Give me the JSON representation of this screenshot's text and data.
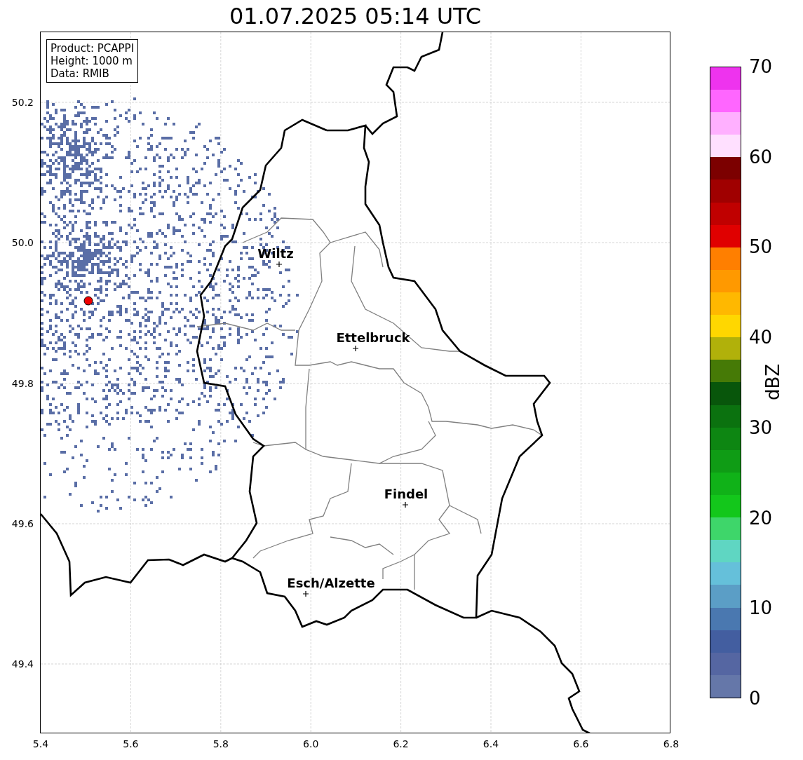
{
  "title": "01.07.2025 05:14 UTC",
  "info_box": [
    "Product: PCAPPI",
    "Height: 1000 m",
    "Data: RMIB"
  ],
  "cities": [
    {
      "name": "Wiltz"
    },
    {
      "name": "Ettelbruck"
    },
    {
      "name": "Findel"
    },
    {
      "name": "Esch/Alzette"
    }
  ],
  "x_ticks": [
    "5.4",
    "5.6",
    "5.8",
    "6.0",
    "6.2",
    "6.4",
    "6.6",
    "6.8"
  ],
  "y_ticks": [
    "50.2",
    "50.0",
    "49.8",
    "49.6",
    "49.4"
  ],
  "colorbar": {
    "label": "dBZ",
    "ticks": [
      "70",
      "60",
      "50",
      "40",
      "30",
      "20",
      "10",
      "0"
    ],
    "segments": [
      {
        "color": "#6577a9"
      },
      {
        "color": "#5566a2"
      },
      {
        "color": "#435ea0"
      },
      {
        "color": "#4a78b0"
      },
      {
        "color": "#5b9ec6"
      },
      {
        "color": "#65c0da"
      },
      {
        "color": "#5fd6c2"
      },
      {
        "color": "#3ed66a"
      },
      {
        "color": "#13c71b"
      },
      {
        "color": "#10b218"
      },
      {
        "color": "#0f9c15"
      },
      {
        "color": "#0d8612"
      },
      {
        "color": "#0b720f"
      },
      {
        "color": "#08560b"
      },
      {
        "color": "#467a06"
      },
      {
        "color": "#b1b10a"
      },
      {
        "color": "#ffd700"
      },
      {
        "color": "#ffb800"
      },
      {
        "color": "#ff9900"
      },
      {
        "color": "#ff7f00"
      },
      {
        "color": "#e00000"
      },
      {
        "color": "#c00000"
      },
      {
        "color": "#a00000"
      },
      {
        "color": "#7c0000"
      },
      {
        "color": "#ffe0ff"
      },
      {
        "color": "#ffb0ff"
      },
      {
        "color": "#ff66ff"
      },
      {
        "color": "#ee33ee"
      }
    ]
  }
}
